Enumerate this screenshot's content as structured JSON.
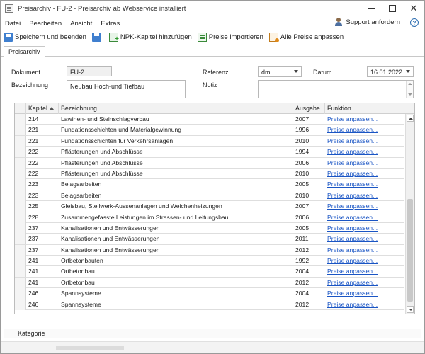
{
  "window": {
    "title": "Preisarchiv - FU-2 - Preisarchiv ab Webservice installiert"
  },
  "menu": {
    "items": [
      "Datei",
      "Bearbeiten",
      "Ansicht",
      "Extras"
    ],
    "support_label": "Support anfordern",
    "help_glyph": "?"
  },
  "toolbar": {
    "save_exit_label": "Speichern und beenden",
    "add_npk_label": "NPK-Kapitel hinzufügen",
    "import_label": "Preise importieren",
    "adjust_all_label": "Alle Preise anpassen"
  },
  "tabs": [
    "Preisarchiv"
  ],
  "form": {
    "dokument_label": "Dokument",
    "dokument_value": "FU-2",
    "bezeichnung_label": "Bezeichnung",
    "bezeichnung_value": "Neubau Hoch-und Tiefbau",
    "referenz_label": "Referenz",
    "referenz_value": "dm",
    "datum_label": "Datum",
    "datum_value": "16.01.2022",
    "notiz_label": "Notiz",
    "notiz_value": ""
  },
  "grid": {
    "columns": [
      "Kapitel",
      "Bezeichnung",
      "Ausgabe",
      "Funktion"
    ],
    "link_label": "Preise anpassen...",
    "rows": [
      {
        "kapitel": "214",
        "bezeichnung": "Lawinen- und Steinschlagverbau",
        "ausgabe": "2007"
      },
      {
        "kapitel": "221",
        "bezeichnung": "Fundationsschichten und Materialgewinnung",
        "ausgabe": "1996"
      },
      {
        "kapitel": "221",
        "bezeichnung": "Fundationsschichten für Verkehrsanlagen",
        "ausgabe": "2010"
      },
      {
        "kapitel": "222",
        "bezeichnung": "Pflästerungen und Abschlüsse",
        "ausgabe": "1994"
      },
      {
        "kapitel": "222",
        "bezeichnung": "Pflästerungen und Abschlüsse",
        "ausgabe": "2006"
      },
      {
        "kapitel": "222",
        "bezeichnung": "Pflästerungen und Abschlüsse",
        "ausgabe": "2010"
      },
      {
        "kapitel": "223",
        "bezeichnung": "Belagsarbeiten",
        "ausgabe": "2005"
      },
      {
        "kapitel": "223",
        "bezeichnung": "Belagsarbeiten",
        "ausgabe": "2010"
      },
      {
        "kapitel": "225",
        "bezeichnung": "Gleisbau, Stellwerk-Aussenanlagen und Weichenheizungen",
        "ausgabe": "2007"
      },
      {
        "kapitel": "228",
        "bezeichnung": "Zusammengefasste Leistungen im Strassen- und Leitungsbau",
        "ausgabe": "2006"
      },
      {
        "kapitel": "237",
        "bezeichnung": "Kanalisationen und Entwässerungen",
        "ausgabe": "2005"
      },
      {
        "kapitel": "237",
        "bezeichnung": "Kanalisationen und Entwässerungen",
        "ausgabe": "2011"
      },
      {
        "kapitel": "237",
        "bezeichnung": "Kanalisationen und Entwässerungen",
        "ausgabe": "2012"
      },
      {
        "kapitel": "241",
        "bezeichnung": "Ortbetonbauten",
        "ausgabe": "1992"
      },
      {
        "kapitel": "241",
        "bezeichnung": "Ortbetonbau",
        "ausgabe": "2004"
      },
      {
        "kapitel": "241",
        "bezeichnung": "Ortbetonbau",
        "ausgabe": "2012"
      },
      {
        "kapitel": "246",
        "bezeichnung": "Spannsysteme",
        "ausgabe": "2004"
      },
      {
        "kapitel": "246",
        "bezeichnung": "Spannsysteme",
        "ausgabe": "2012"
      }
    ]
  },
  "footer": {
    "category_label": "Kategorie"
  }
}
